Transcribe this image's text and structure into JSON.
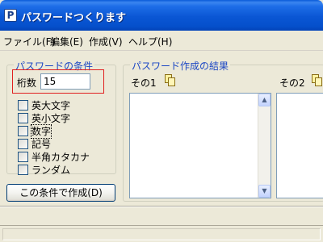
{
  "window": {
    "title": "パスワードつくります",
    "icon_letter": "P"
  },
  "menu": [
    {
      "label": "ファイル(F)"
    },
    {
      "label": "編集(E)"
    },
    {
      "label": "作成(V)"
    },
    {
      "label": "ヘルプ(H)"
    }
  ],
  "conditions": {
    "group_title": "パスワードの条件",
    "digits_label": "桁数",
    "digits_value": "15",
    "options": [
      {
        "label": "英大文字",
        "checked": false
      },
      {
        "label": "英小文字",
        "checked": false
      },
      {
        "label": "数字",
        "checked": false
      },
      {
        "label": "記号",
        "checked": false
      },
      {
        "label": "半角カタカナ",
        "checked": false
      },
      {
        "label": "ランダム",
        "checked": false
      }
    ],
    "create_button": "この条件で作成(D)"
  },
  "results": {
    "group_title": "パスワード作成の結果",
    "col1_label": "その1",
    "col2_label": "その2",
    "copy_icon": "copy-icon"
  },
  "scroll_arrows": {
    "up": "▲",
    "down": "▼"
  },
  "colors": {
    "title_blue": "#0a56d4",
    "group_title": "#1c47c4",
    "highlight_red": "#e02020"
  }
}
